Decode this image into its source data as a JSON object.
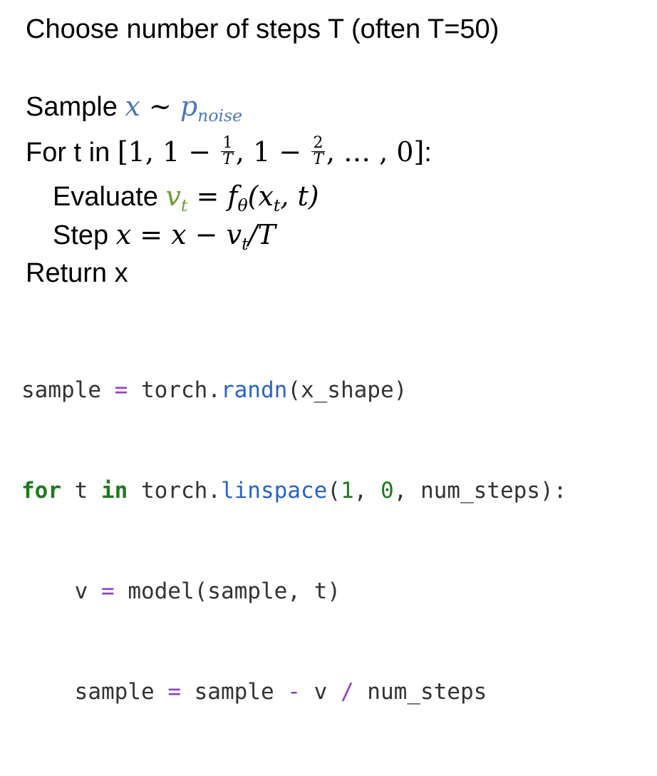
{
  "slide": {
    "heading": "Choose number of steps T (often T=50)",
    "line_sample": {
      "label": "Sample ",
      "var": "x",
      "tilde": " ~ ",
      "dist": "p",
      "dist_sub": "noise"
    },
    "line_for": {
      "label": "For t in ",
      "open": "[1, 1 − ",
      "frac1_num": "1",
      "frac_den": "T",
      "mid": ", 1 − ",
      "frac2_num": "2",
      "tail": ", … , 0]",
      "colon": ":"
    },
    "line_eval": {
      "label": "Evaluate ",
      "v": "v",
      "v_sub": "t",
      "rest": " = f",
      "f_sub": "θ",
      "args_open": "(x",
      "x_sub": "t",
      "args_close": ", t)"
    },
    "line_step": {
      "label": "Step ",
      "expr": "x = x − v",
      "v_sub": "t",
      "tail": "/T"
    },
    "line_return": "Return x"
  },
  "code": {
    "lines": [
      [
        {
          "text": "sample ",
          "cls": "plain"
        },
        {
          "text": "=",
          "cls": "op"
        },
        {
          "text": " torch.",
          "cls": "plain"
        },
        {
          "text": "randn",
          "cls": "fn"
        },
        {
          "text": "(x_shape)",
          "cls": "plain"
        }
      ],
      [
        {
          "text": "for",
          "cls": "kw"
        },
        {
          "text": " t ",
          "cls": "plain"
        },
        {
          "text": "in",
          "cls": "kw"
        },
        {
          "text": " torch.",
          "cls": "plain"
        },
        {
          "text": "linspace",
          "cls": "fn"
        },
        {
          "text": "(",
          "cls": "plain"
        },
        {
          "text": "1",
          "cls": "num-lit"
        },
        {
          "text": ", ",
          "cls": "plain"
        },
        {
          "text": "0",
          "cls": "num-lit"
        },
        {
          "text": ", num_steps):",
          "cls": "plain"
        }
      ],
      [
        {
          "text": "    v ",
          "cls": "plain"
        },
        {
          "text": "=",
          "cls": "op"
        },
        {
          "text": " model(sample, t)",
          "cls": "plain"
        }
      ],
      [
        {
          "text": "    sample ",
          "cls": "plain"
        },
        {
          "text": "=",
          "cls": "op"
        },
        {
          "text": " sample ",
          "cls": "plain"
        },
        {
          "text": "-",
          "cls": "op"
        },
        {
          "text": " v ",
          "cls": "plain"
        },
        {
          "text": "/",
          "cls": "op"
        },
        {
          "text": " num_steps",
          "cls": "plain"
        }
      ]
    ]
  },
  "colors": {
    "math_blue": "#4a7ab5",
    "math_green": "#6e9d35",
    "keyword": "#1e7a1e",
    "function": "#2b62c9",
    "operator": "#8e3fc4"
  }
}
